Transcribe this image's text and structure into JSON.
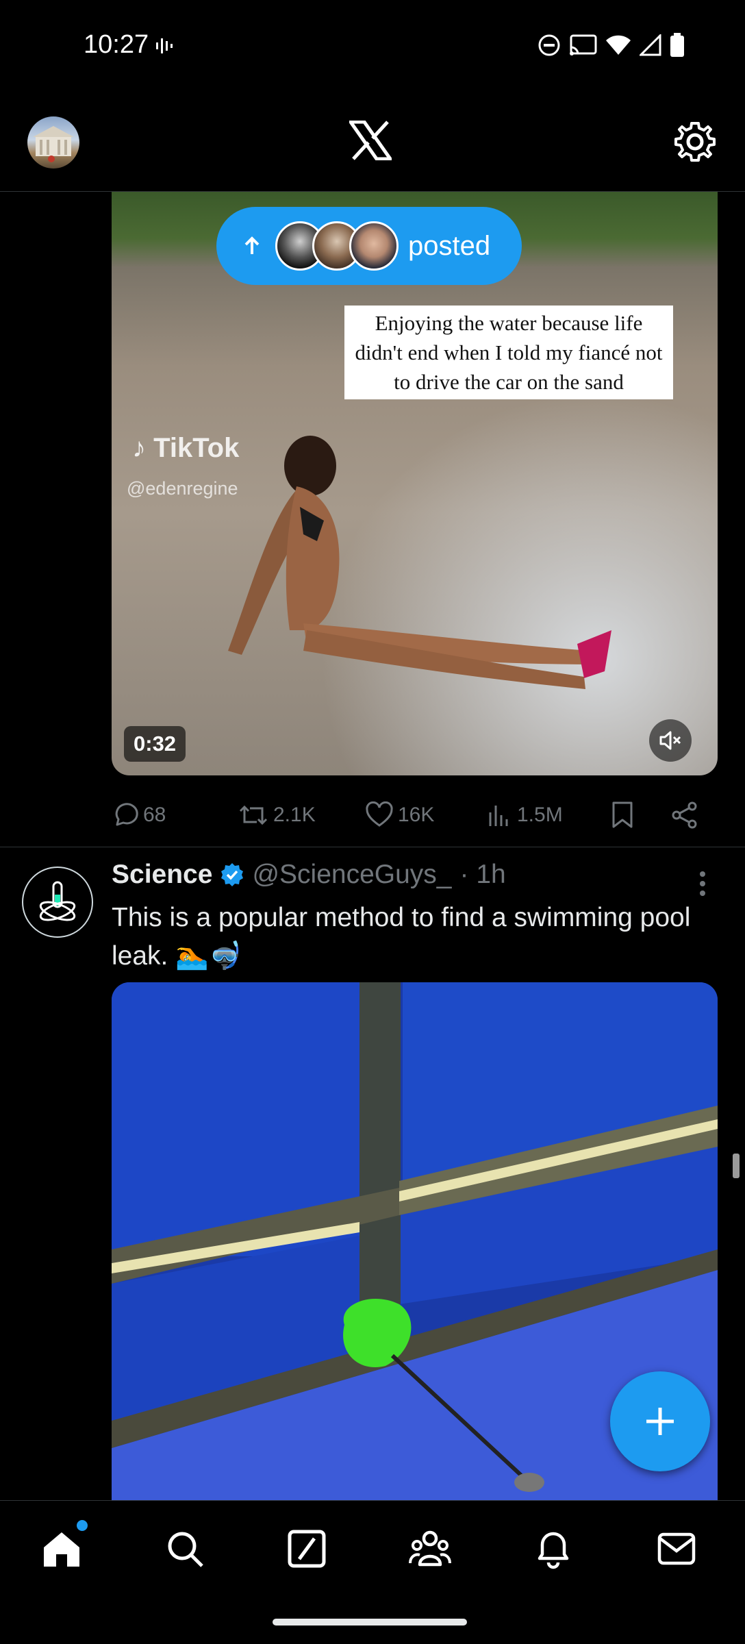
{
  "status_bar": {
    "time": "10:27"
  },
  "top_bar": {
    "logo": "X"
  },
  "post1": {
    "posted_pill_label": "posted",
    "video_caption": "Enjoying  the water because life didn't end when I told my fiancé not to drive the car on the sand",
    "watermark": "TikTok",
    "watermark_handle": "@edenregine",
    "duration": "0:32",
    "stats": {
      "replies": "68",
      "reposts": "2.1K",
      "likes": "16K",
      "views": "1.5M"
    }
  },
  "post2": {
    "name": "Science",
    "handle": "@ScienceGuys_",
    "time": "· 1h",
    "text": "This is a popular method to find a swimming pool leak. 🏊🤿"
  },
  "colors": {
    "accent": "#1d9bf0",
    "background": "#000000",
    "muted": "#71767b"
  },
  "icons": [
    "home-icon",
    "search-icon",
    "grok-icon",
    "communities-icon",
    "notifications-icon",
    "messages-icon",
    "compose-plus-icon",
    "settings-gear-icon"
  ]
}
